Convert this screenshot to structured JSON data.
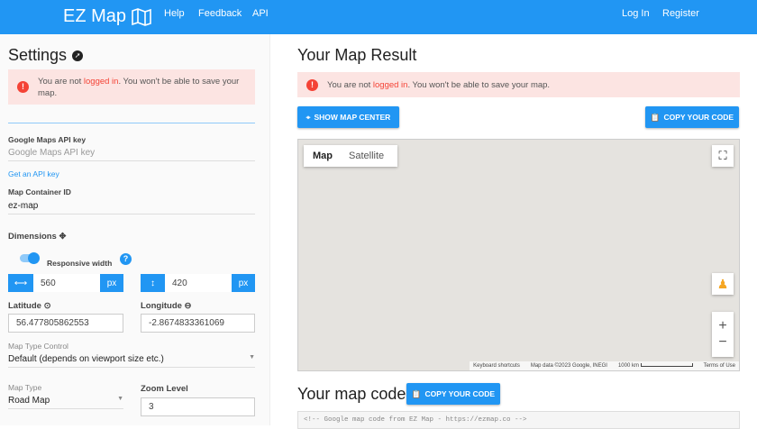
{
  "header": {
    "logo": "EZ Map",
    "nav": [
      "Help",
      "Feedback",
      "API"
    ],
    "login": "Log In",
    "register": "Register"
  },
  "settings": {
    "title": "Settings",
    "alert": {
      "pre": "You are not ",
      "link": "logged in",
      "post": ". You won't be able to save your map."
    },
    "api_key_label": "Google Maps API key",
    "api_key_placeholder": "Google Maps API key",
    "get_key": "Get an API key",
    "container_label": "Map Container ID",
    "container_value": "ez-map",
    "dimensions": "Dimensions",
    "responsive": "Responsive width",
    "responsive_on": true,
    "width": "560",
    "height": "420",
    "unit": "px",
    "lat_label": "Latitude",
    "lat": "56.477805862553",
    "lng_label": "Longitude",
    "lng": "-2.8674833361069",
    "mtc_label": "Map Type Control",
    "mtc_value": "Default (depends on viewport size etc.)",
    "mt_label": "Map Type",
    "mt_value": "Road Map",
    "zoom_label": "Zoom Level",
    "zoom_value": "3"
  },
  "result": {
    "title": "Your Map Result",
    "alert": {
      "pre": "You are not ",
      "link": "logged in",
      "post": ". You won't be able to save your map."
    },
    "show_center": "SHOW MAP CENTER",
    "copy": "COPY YOUR CODE",
    "map_tab": "Map",
    "satellite_tab": "Satellite",
    "footer": {
      "shortcuts": "Keyboard shortcuts",
      "data": "Map data ©2023 Google, INEGI",
      "scale": "1000 km",
      "terms": "Terms of Use"
    },
    "code_title": "Your map code",
    "code_copy": "COPY YOUR CODE",
    "code_line": "<!-- Google map code from EZ Map - https://ezmap.co -->"
  }
}
